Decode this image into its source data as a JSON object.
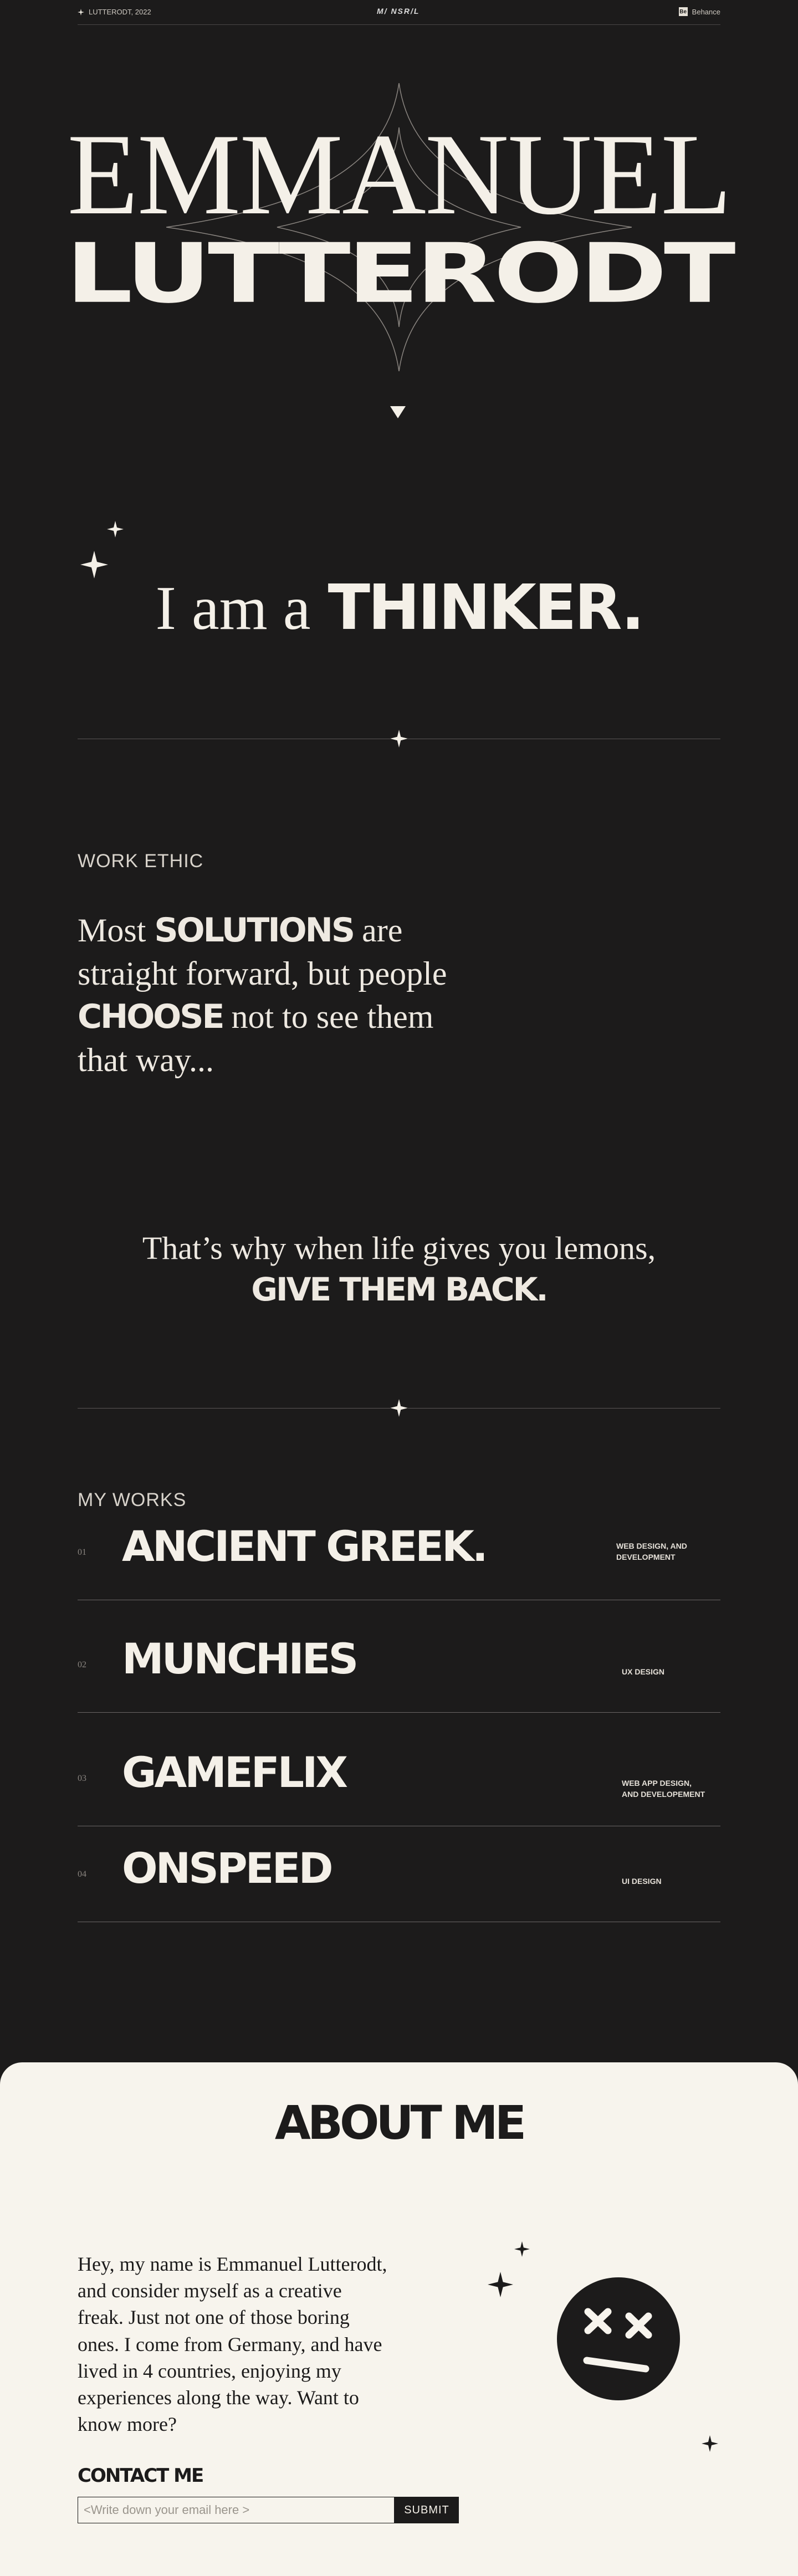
{
  "topbar": {
    "left_text": "LUTTERODT, 2022",
    "center_logo": "M/ NSR/L",
    "right_icon": "Be",
    "right_text": "Behance"
  },
  "hero": {
    "line1": "EMMANUEL",
    "line2": "LUTTERODT"
  },
  "thinker": {
    "part1": "I am a",
    "part2": "THINKER."
  },
  "work_ethic": {
    "label": "WORK ETHIC",
    "line1_a": "Most",
    "line1_b": "SOLUTIONS",
    "line1_c": "are",
    "line2": "straight forward, but people",
    "line3_a": "CHOOSE",
    "line3_b": "not to see them",
    "line4": "that way..."
  },
  "lemons": {
    "line1": "That’s why when life gives you lemons,",
    "line2": "GIVE THEM BACK."
  },
  "works": {
    "label": "MY WORKS",
    "items": [
      {
        "num": "01",
        "title": "ANCIENT GREEK.",
        "tag1": "WEB DESIGN, AND",
        "tag2": "DEVELOPMENT"
      },
      {
        "num": "02",
        "title": "MUNCHIES",
        "tag1": "UX DESIGN",
        "tag2": ""
      },
      {
        "num": "03",
        "title": "GAMEFLIX",
        "tag1": "WEB APP DESIGN,",
        "tag2": "AND DEVELOPEMENT"
      },
      {
        "num": "04",
        "title": "ONSPEED",
        "tag1": "UI DESIGN",
        "tag2": ""
      }
    ]
  },
  "about": {
    "title": "ABOUT ME",
    "text": "Hey, my name is Emmanuel Lutterodt, and consider myself as a creative freak. Just not one of those boring ones. I come from Germany, and have lived in 4 countries, enjoying my experiences along the way. Want to know more?",
    "contact_title": "CONTACT ME",
    "email_placeholder": "<Write down your email here >",
    "submit_label": "SUBMIT"
  },
  "colors": {
    "dark": "#1c1b1b",
    "cream": "#f7f4ed",
    "text_light": "#f4f0e8"
  }
}
